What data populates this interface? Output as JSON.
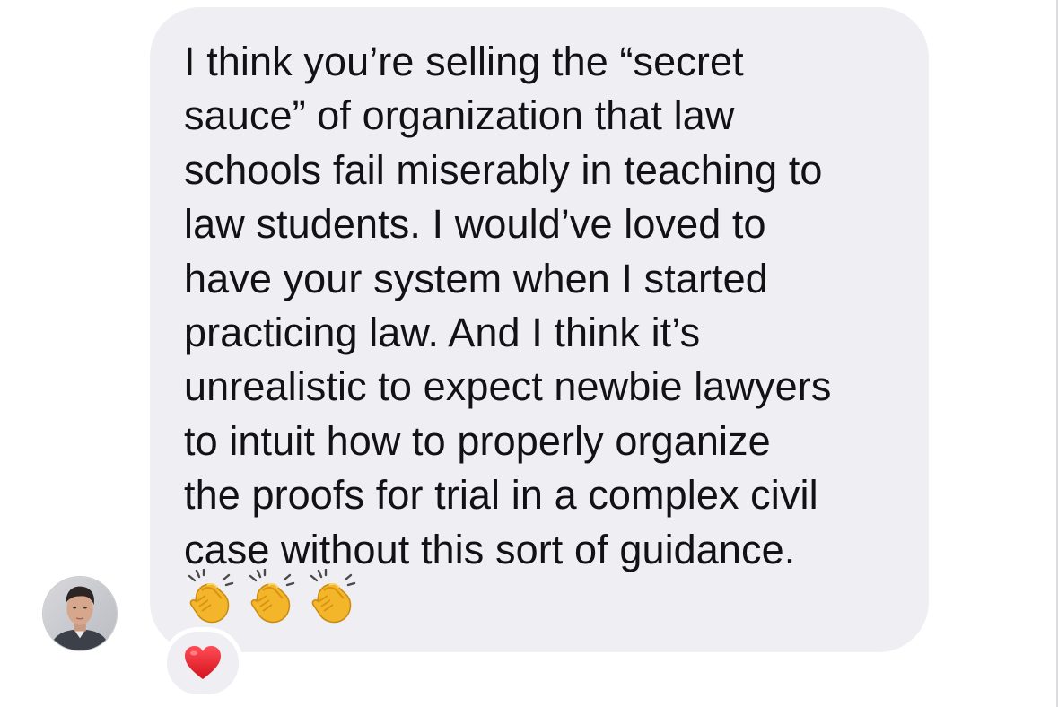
{
  "message": {
    "text": "I think you’re selling the “secret\nsauce” of organization that law\nschools fail miserably in teaching to\nlaw students.  I would’ve loved to\nhave your system when I started\npracticing law. And I think it’s\nunrealistic to expect newbie lawyers\nto intuit how to properly organize\nthe proofs for trial in a complex civil\ncase without this sort of guidance.",
    "emojis": [
      "clapping-hands",
      "clapping-hands",
      "clapping-hands"
    ]
  },
  "sender": {
    "avatar_icon": "person-photo-avatar"
  },
  "reaction": {
    "icon": "red-heart",
    "color": "#e0202a"
  },
  "colors": {
    "bubble": "#eeeef3",
    "text": "#121214",
    "background": "#ffffff"
  }
}
